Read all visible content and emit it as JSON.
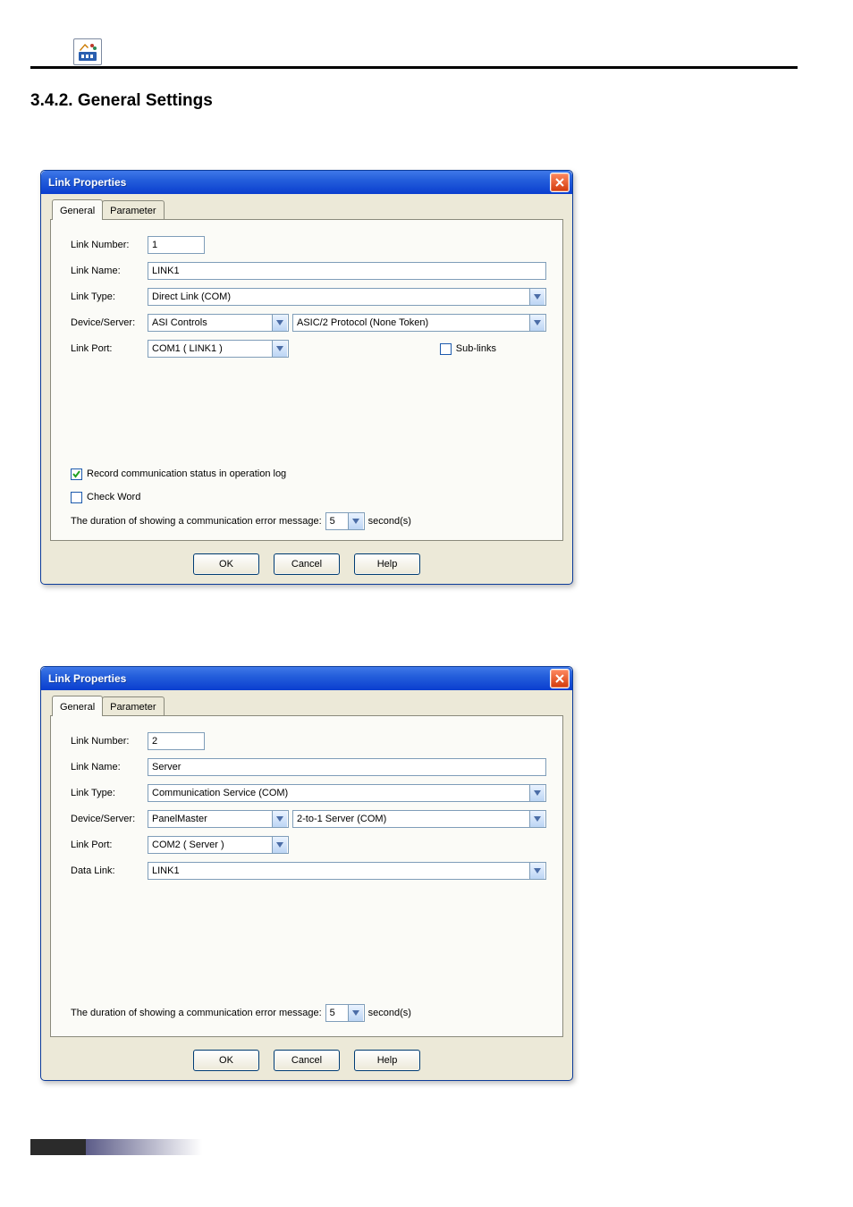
{
  "page": {
    "section_heading": "3.4.2. General Settings"
  },
  "dialog1": {
    "title": "Link Properties",
    "tabs": {
      "general": "General",
      "parameter": "Parameter"
    },
    "labels": {
      "link_number": "Link Number:",
      "link_name": "Link Name:",
      "link_type": "Link Type:",
      "device_server": "Device/Server:",
      "link_port": "Link Port:"
    },
    "values": {
      "link_number": "1",
      "link_name": "LINK1",
      "link_type": "Direct Link (COM)",
      "device_server_a": "ASI Controls",
      "device_server_b": "ASIC/2 Protocol (None Token)",
      "link_port": "COM1 ( LINK1 )"
    },
    "checks": {
      "sub_links": "Sub-links",
      "record_log": "Record communication status in operation log",
      "check_word": "Check Word"
    },
    "duration": {
      "label": "The duration of showing a communication error message:",
      "value": "5",
      "unit": "second(s)"
    },
    "buttons": {
      "ok": "OK",
      "cancel": "Cancel",
      "help": "Help"
    }
  },
  "dialog2": {
    "title": "Link Properties",
    "tabs": {
      "general": "General",
      "parameter": "Parameter"
    },
    "labels": {
      "link_number": "Link Number:",
      "link_name": "Link Name:",
      "link_type": "Link Type:",
      "device_server": "Device/Server:",
      "link_port": "Link Port:",
      "data_link": "Data Link:"
    },
    "values": {
      "link_number": "2",
      "link_name": "Server",
      "link_type": "Communication Service (COM)",
      "device_server_a": "PanelMaster",
      "device_server_b": "2-to-1 Server (COM)",
      "link_port": "COM2 ( Server )",
      "data_link": "LINK1"
    },
    "duration": {
      "label": "The duration of showing a communication error message:",
      "value": "5",
      "unit": "second(s)"
    },
    "buttons": {
      "ok": "OK",
      "cancel": "Cancel",
      "help": "Help"
    }
  }
}
